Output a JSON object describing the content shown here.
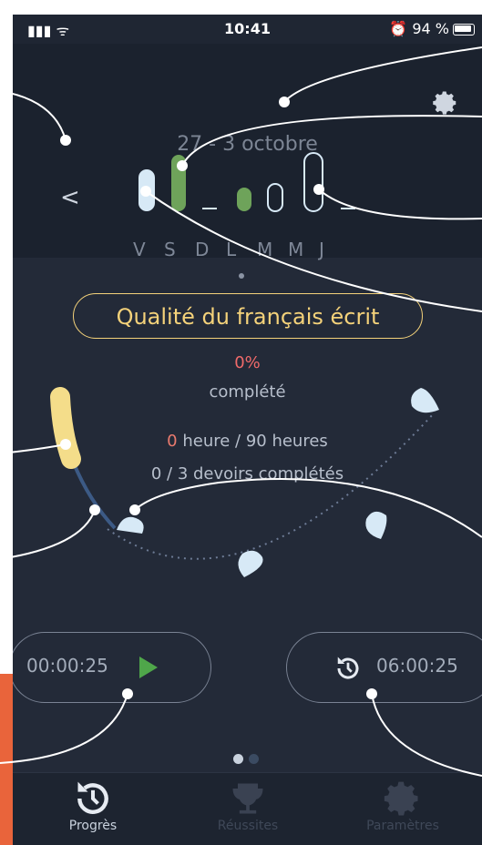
{
  "status_bar": {
    "signal": "▮▮▮",
    "time": "10:41",
    "alarm": "⏰",
    "battery": "94 %"
  },
  "header": {
    "date_range": "27 - 3 octobre",
    "days": [
      "V",
      "S",
      "D",
      "L",
      "M",
      "M",
      "J"
    ]
  },
  "course": {
    "title": "Qualité du français écrit",
    "percent": "0%",
    "completed_label": "complété",
    "hours_done": "0",
    "hours_rest": " heure / 90 heures",
    "homework": "0 / 3 devoirs complétés"
  },
  "timers": {
    "elapsed": "00:00:25",
    "target": "06:00:25"
  },
  "tabs": [
    {
      "label": "Progrès",
      "active": true
    },
    {
      "label": "Réussites",
      "active": false
    },
    {
      "label": "Paramètres",
      "active": false
    }
  ],
  "colors": {
    "accent": "#f4d27a",
    "green": "#4fa64a",
    "background": "#232a38"
  }
}
